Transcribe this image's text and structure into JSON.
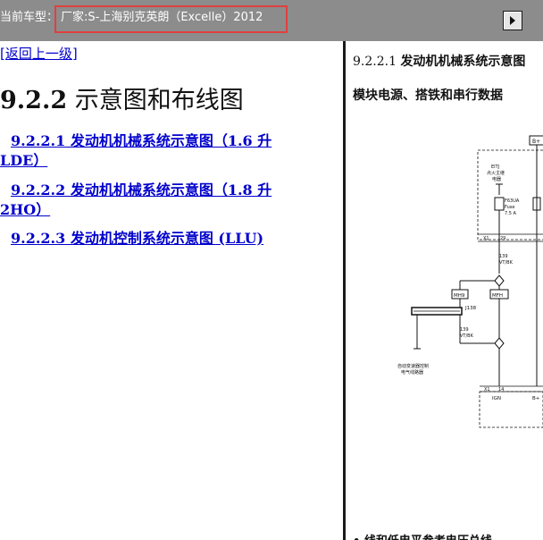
{
  "header": {
    "car_label": "当前车型：",
    "car_value": "厂家:S-上海别克英朗（Excelle）2012",
    "expand_icon": "expand-icon"
  },
  "left": {
    "back_link": "[返回上一级]",
    "section_number": "9.2.2",
    "section_title": " 示意图和布线图",
    "links": [
      {
        "line1": "9.2.2.1 发动机机械系统示意图（1.6 升",
        "line2": "LDE）"
      },
      {
        "line1": "9.2.2.2 发动机机械系统示意图（1.8 升",
        "line2": "2HO）"
      },
      {
        "line1": "9.2.2.3 发动机控制系统示意图 (LLU)",
        "line2": ""
      }
    ]
  },
  "right": {
    "heading_number": "9.2.2.1 ",
    "heading_title": "发动机机械系统示意图",
    "subheading": "模块电源、搭铁和串行数据",
    "bottom_text": "• 线和低电平参考电压总线",
    "diagram": {
      "b_plus_top": "B+",
      "fuse_block": "EITJ",
      "fuse_block_sub1": "点火主继",
      "fuse_block_sub2": "电器",
      "fuse_name": "F63UA",
      "fuse_sub": "Fuse",
      "fuse_rating": "7.5 A",
      "x1_label": "X1",
      "pin_29": "29",
      "wire_139_a": "139",
      "wire_color_a": "VT/BK",
      "mh9": "MH9",
      "mfh": "MFH",
      "j138": "J138",
      "wire_139_b": "139",
      "wire_color_b": "VT/BK",
      "module_label1": "自动变速器控制",
      "module_label2": "电气线路器",
      "x1_bottom": "X1",
      "pin_14": "14",
      "ign": "IGN",
      "b_plus_bottom": "B+"
    }
  }
}
